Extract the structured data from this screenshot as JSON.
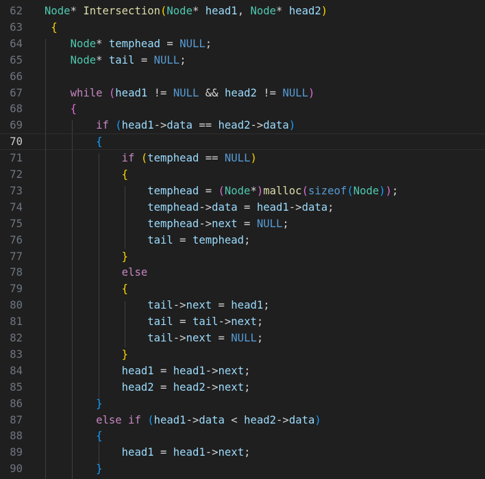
{
  "editor": {
    "lines": [
      {
        "num": "62",
        "tokens": [
          [
            "t-type",
            "Node"
          ],
          [
            "t-op",
            "* "
          ],
          [
            "t-func",
            "Intersection"
          ],
          [
            "b1",
            "("
          ],
          [
            "t-type",
            "Node"
          ],
          [
            "t-op",
            "* "
          ],
          [
            "t-var",
            "head1"
          ],
          [
            "t-op",
            ", "
          ],
          [
            "t-type",
            "Node"
          ],
          [
            "t-op",
            "* "
          ],
          [
            "t-var",
            "head2"
          ],
          [
            "b1",
            ")"
          ]
        ]
      },
      {
        "num": "63",
        "tokens": [
          [
            "t-op",
            " "
          ],
          [
            "b1",
            "{"
          ]
        ]
      },
      {
        "num": "64",
        "tokens": [
          [
            "t-op",
            "    "
          ],
          [
            "t-type",
            "Node"
          ],
          [
            "t-op",
            "* "
          ],
          [
            "t-var",
            "temphead"
          ],
          [
            "t-op",
            " = "
          ],
          [
            "t-const",
            "NULL"
          ],
          [
            "t-op",
            ";"
          ]
        ]
      },
      {
        "num": "65",
        "tokens": [
          [
            "t-op",
            "    "
          ],
          [
            "t-type",
            "Node"
          ],
          [
            "t-op",
            "* "
          ],
          [
            "t-var",
            "tail"
          ],
          [
            "t-op",
            " = "
          ],
          [
            "t-const",
            "NULL"
          ],
          [
            "t-op",
            ";"
          ]
        ]
      },
      {
        "num": "66",
        "tokens": []
      },
      {
        "num": "67",
        "tokens": [
          [
            "t-op",
            "    "
          ],
          [
            "t-kw",
            "while"
          ],
          [
            "t-op",
            " "
          ],
          [
            "b2",
            "("
          ],
          [
            "t-var",
            "head1"
          ],
          [
            "t-op",
            " != "
          ],
          [
            "t-const",
            "NULL"
          ],
          [
            "t-op",
            " && "
          ],
          [
            "t-var",
            "head2"
          ],
          [
            "t-op",
            " != "
          ],
          [
            "t-const",
            "NULL"
          ],
          [
            "b2",
            ")"
          ]
        ]
      },
      {
        "num": "68",
        "tokens": [
          [
            "t-op",
            "    "
          ],
          [
            "b2",
            "{"
          ]
        ]
      },
      {
        "num": "69",
        "tokens": [
          [
            "t-op",
            "        "
          ],
          [
            "t-kw",
            "if"
          ],
          [
            "t-op",
            " "
          ],
          [
            "b3",
            "("
          ],
          [
            "t-var",
            "head1"
          ],
          [
            "t-op",
            "->"
          ],
          [
            "t-var",
            "data"
          ],
          [
            "t-op",
            " == "
          ],
          [
            "t-var",
            "head2"
          ],
          [
            "t-op",
            "->"
          ],
          [
            "t-var",
            "data"
          ],
          [
            "b3",
            ")"
          ]
        ]
      },
      {
        "num": "70",
        "current": true,
        "tokens": [
          [
            "t-op",
            "        "
          ],
          [
            "b3",
            "{"
          ]
        ]
      },
      {
        "num": "71",
        "tokens": [
          [
            "t-op",
            "            "
          ],
          [
            "t-kw",
            "if"
          ],
          [
            "t-op",
            " "
          ],
          [
            "b1",
            "("
          ],
          [
            "t-var",
            "temphead"
          ],
          [
            "t-op",
            " == "
          ],
          [
            "t-const",
            "NULL"
          ],
          [
            "b1",
            ")"
          ]
        ]
      },
      {
        "num": "72",
        "tokens": [
          [
            "t-op",
            "            "
          ],
          [
            "b1",
            "{"
          ]
        ]
      },
      {
        "num": "73",
        "tokens": [
          [
            "t-op",
            "                "
          ],
          [
            "t-var",
            "temphead"
          ],
          [
            "t-op",
            " = "
          ],
          [
            "b2",
            "("
          ],
          [
            "t-type",
            "Node"
          ],
          [
            "t-op",
            "*"
          ],
          [
            "b2",
            ")"
          ],
          [
            "t-func",
            "malloc"
          ],
          [
            "b2",
            "("
          ],
          [
            "t-const",
            "sizeof"
          ],
          [
            "b3",
            "("
          ],
          [
            "t-type",
            "Node"
          ],
          [
            "b3",
            ")"
          ],
          [
            "b2",
            ")"
          ],
          [
            "t-op",
            ";"
          ]
        ]
      },
      {
        "num": "74",
        "tokens": [
          [
            "t-op",
            "                "
          ],
          [
            "t-var",
            "temphead"
          ],
          [
            "t-op",
            "->"
          ],
          [
            "t-var",
            "data"
          ],
          [
            "t-op",
            " = "
          ],
          [
            "t-var",
            "head1"
          ],
          [
            "t-op",
            "->"
          ],
          [
            "t-var",
            "data"
          ],
          [
            "t-op",
            ";"
          ]
        ]
      },
      {
        "num": "75",
        "tokens": [
          [
            "t-op",
            "                "
          ],
          [
            "t-var",
            "temphead"
          ],
          [
            "t-op",
            "->"
          ],
          [
            "t-var",
            "next"
          ],
          [
            "t-op",
            " = "
          ],
          [
            "t-const",
            "NULL"
          ],
          [
            "t-op",
            ";"
          ]
        ]
      },
      {
        "num": "76",
        "tokens": [
          [
            "t-op",
            "                "
          ],
          [
            "t-var",
            "tail"
          ],
          [
            "t-op",
            " = "
          ],
          [
            "t-var",
            "temphead"
          ],
          [
            "t-op",
            ";"
          ]
        ]
      },
      {
        "num": "77",
        "tokens": [
          [
            "t-op",
            "            "
          ],
          [
            "b1",
            "}"
          ]
        ]
      },
      {
        "num": "78",
        "tokens": [
          [
            "t-op",
            "            "
          ],
          [
            "t-kw",
            "else"
          ]
        ]
      },
      {
        "num": "79",
        "tokens": [
          [
            "t-op",
            "            "
          ],
          [
            "b1",
            "{"
          ]
        ]
      },
      {
        "num": "80",
        "tokens": [
          [
            "t-op",
            "                "
          ],
          [
            "t-var",
            "tail"
          ],
          [
            "t-op",
            "->"
          ],
          [
            "t-var",
            "next"
          ],
          [
            "t-op",
            " = "
          ],
          [
            "t-var",
            "head1"
          ],
          [
            "t-op",
            ";"
          ]
        ]
      },
      {
        "num": "81",
        "tokens": [
          [
            "t-op",
            "                "
          ],
          [
            "t-var",
            "tail"
          ],
          [
            "t-op",
            " = "
          ],
          [
            "t-var",
            "tail"
          ],
          [
            "t-op",
            "->"
          ],
          [
            "t-var",
            "next"
          ],
          [
            "t-op",
            ";"
          ]
        ]
      },
      {
        "num": "82",
        "tokens": [
          [
            "t-op",
            "                "
          ],
          [
            "t-var",
            "tail"
          ],
          [
            "t-op",
            "->"
          ],
          [
            "t-var",
            "next"
          ],
          [
            "t-op",
            " = "
          ],
          [
            "t-const",
            "NULL"
          ],
          [
            "t-op",
            ";"
          ]
        ]
      },
      {
        "num": "83",
        "tokens": [
          [
            "t-op",
            "            "
          ],
          [
            "b1",
            "}"
          ]
        ]
      },
      {
        "num": "84",
        "tokens": [
          [
            "t-op",
            "            "
          ],
          [
            "t-var",
            "head1"
          ],
          [
            "t-op",
            " = "
          ],
          [
            "t-var",
            "head1"
          ],
          [
            "t-op",
            "->"
          ],
          [
            "t-var",
            "next"
          ],
          [
            "t-op",
            ";"
          ]
        ]
      },
      {
        "num": "85",
        "tokens": [
          [
            "t-op",
            "            "
          ],
          [
            "t-var",
            "head2"
          ],
          [
            "t-op",
            " = "
          ],
          [
            "t-var",
            "head2"
          ],
          [
            "t-op",
            "->"
          ],
          [
            "t-var",
            "next"
          ],
          [
            "t-op",
            ";"
          ]
        ]
      },
      {
        "num": "86",
        "tokens": [
          [
            "t-op",
            "        "
          ],
          [
            "b3",
            "}"
          ]
        ]
      },
      {
        "num": "87",
        "tokens": [
          [
            "t-op",
            "        "
          ],
          [
            "t-kw",
            "else if"
          ],
          [
            "t-op",
            " "
          ],
          [
            "b3",
            "("
          ],
          [
            "t-var",
            "head1"
          ],
          [
            "t-op",
            "->"
          ],
          [
            "t-var",
            "data"
          ],
          [
            "t-op",
            " < "
          ],
          [
            "t-var",
            "head2"
          ],
          [
            "t-op",
            "->"
          ],
          [
            "t-var",
            "data"
          ],
          [
            "b3",
            ")"
          ]
        ]
      },
      {
        "num": "88",
        "tokens": [
          [
            "t-op",
            "        "
          ],
          [
            "b3",
            "{"
          ]
        ]
      },
      {
        "num": "89",
        "tokens": [
          [
            "t-op",
            "            "
          ],
          [
            "t-var",
            "head1"
          ],
          [
            "t-op",
            " = "
          ],
          [
            "t-var",
            "head1"
          ],
          [
            "t-op",
            "->"
          ],
          [
            "t-var",
            "next"
          ],
          [
            "t-op",
            ";"
          ]
        ]
      },
      {
        "num": "90",
        "tokens": [
          [
            "t-op",
            "        "
          ],
          [
            "b3",
            "}"
          ]
        ]
      }
    ]
  }
}
